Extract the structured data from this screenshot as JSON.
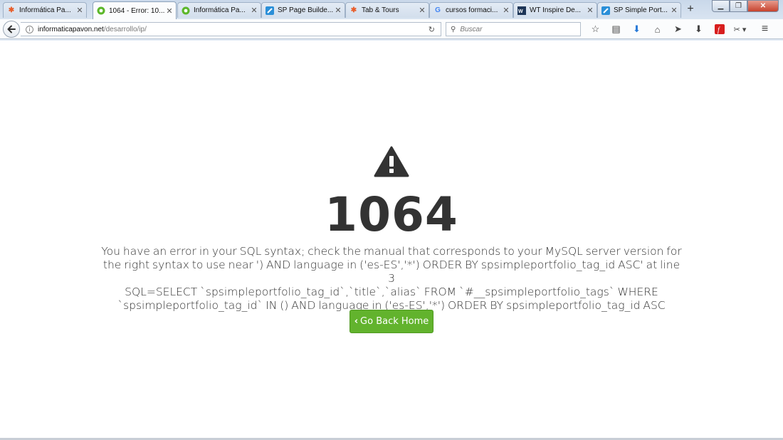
{
  "browser": {
    "tabs": [
      {
        "label": "Informática Pa...",
        "icon": "joomla-icon",
        "active": false
      },
      {
        "label": "1064 - Error: 10...",
        "icon": "site-icon",
        "active": true
      },
      {
        "label": "Informática Pa...",
        "icon": "site-icon",
        "active": false
      },
      {
        "label": "SP Page Builde...",
        "icon": "sp-icon",
        "active": false
      },
      {
        "label": "Tab & Tours",
        "icon": "joomla-icon",
        "active": false
      },
      {
        "label": "cursos formaci...",
        "icon": "google-icon",
        "active": false
      },
      {
        "label": "WT Inspire De...",
        "icon": "wt-icon",
        "active": false
      },
      {
        "label": "SP Simple Port...",
        "icon": "sp-icon",
        "active": false
      }
    ],
    "url": {
      "host": "informaticapavon.net",
      "path": "/desarrollo/ip/"
    },
    "search_placeholder": "Buscar"
  },
  "page": {
    "error_code": "1064",
    "message_lines": [
      "You have an error in your SQL syntax; check the manual that corresponds to your MySQL server version for",
      "the right syntax to use near ') AND language in ('es-ES','*') ORDER BY spsimpleportfolio_tag_id ASC' at line 3",
      "SQL=SELECT `spsimpleportfolio_tag_id`,`title`,`alias` FROM `#__spsimpleportfolio_tags` WHERE",
      "`spsimpleportfolio_tag_id` IN () AND language in ('es-ES','*') ORDER BY spsimpleportfolio_tag_id ASC"
    ],
    "home_button_label": "Go Back Home",
    "colors": {
      "button_green": "#62b32d",
      "text": "#333333"
    }
  }
}
